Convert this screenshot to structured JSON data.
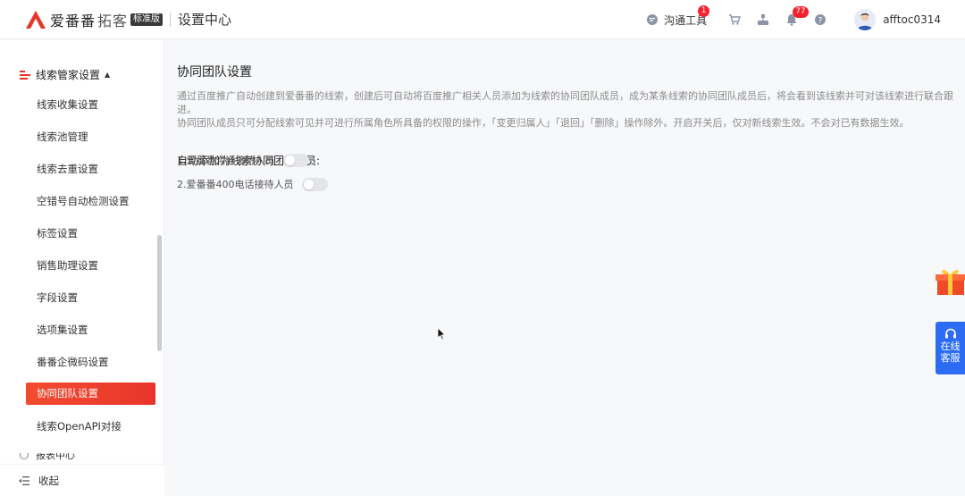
{
  "header": {
    "brand": "爱番番",
    "brand_sub": "拓客",
    "edition": "标准版",
    "section_title": "设置中心",
    "tools_label": "沟通工具",
    "tools_badge": "1",
    "notify_badge": "77",
    "username": "afftoc0314"
  },
  "sidebar": {
    "group_title": "线索管家设置",
    "items": [
      {
        "label": "线索收集设置"
      },
      {
        "label": "线索池管理"
      },
      {
        "label": "线索去重设置"
      },
      {
        "label": "空错号自动检测设置"
      },
      {
        "label": "标签设置"
      },
      {
        "label": "销售助理设置"
      },
      {
        "label": "字段设置"
      },
      {
        "label": "选项集设置"
      },
      {
        "label": "番番企微码设置"
      },
      {
        "label": "协同团队设置"
      },
      {
        "label": "线索OpenAPI对接"
      }
    ],
    "active_index": 9,
    "group2_title": "报表中心",
    "collapse_label": "收起"
  },
  "main": {
    "title": "协同团队设置",
    "desc_line1": "通过百度推广自动创建到爱番番的线索，创建后可自动将百度推广相关人员添加为线索的协同团队成员，成为某条线索的协同团队成员后，将会看到该线索并可对该线索进行联合跟进。",
    "desc_line2": "协同团队成员只可分配线索可见并可进行所属角色所具备的权限的操作，「变更归属人」「退回」「删除」操作除外。开启开关后，仅对新线索生效。不会对已有数据生效。",
    "subtitle": "自动添加为线索协同团队成员:",
    "options": [
      {
        "label": "1.爱番番沟通接待人员",
        "enabled": false
      },
      {
        "label": "2.爱番番400电话接待人员",
        "enabled": false
      }
    ]
  },
  "service": {
    "line1": "在线",
    "line2": "客服"
  },
  "colors": {
    "accent": "#e8352c",
    "service_blue": "#2b6cf2",
    "badge_red": "#f5222d"
  }
}
